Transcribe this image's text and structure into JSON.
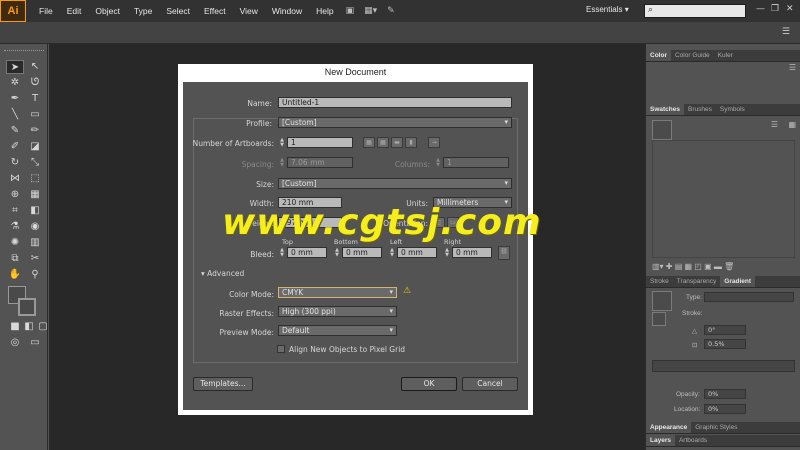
{
  "app": {
    "logo": "Ai",
    "workspace": "Essentials"
  },
  "menu": [
    "File",
    "Edit",
    "Object",
    "Type",
    "Select",
    "Effect",
    "View",
    "Window",
    "Help"
  ],
  "right_panels": {
    "top_tabs": [
      "Color",
      "Color Guide",
      "Kuler"
    ],
    "swatch_tabs": [
      "Swatches",
      "Brushes",
      "Symbols"
    ],
    "gradient_tabs": [
      "Stroke",
      "Transparency",
      "Gradient"
    ],
    "gradient": {
      "type_label": "Type:",
      "stroke_label": "Stroke:",
      "angle_value": "0°",
      "percent_value": "0.5%",
      "opacity_label": "Opacity:",
      "opacity_value": "0%",
      "location_label": "Location:",
      "location_value": "0%"
    },
    "appearance_tabs": [
      "Appearance",
      "Graphic Styles"
    ],
    "layers_tabs": [
      "Layers",
      "Artboards"
    ]
  },
  "dialog": {
    "title": "New Document",
    "name_label": "Name:",
    "name_value": "Untitled-1",
    "profile_label": "Profile:",
    "profile_value": "[Custom]",
    "artboards_label": "Number of Artboards:",
    "artboards_value": "1",
    "spacing_label": "Spacing:",
    "spacing_value": "7.06 mm",
    "columns_label": "Columns:",
    "columns_value": "1",
    "size_label": "Size:",
    "size_value": "[Custom]",
    "width_label": "Width:",
    "width_value": "210 mm",
    "units_label": "Units:",
    "units_value": "Millimeters",
    "height_label": "Height:",
    "height_value": "297 mm",
    "orientation_label": "Orientation:",
    "bleed_label": "Bleed:",
    "bleed_top_label": "Top",
    "bleed_bottom_label": "Bottom",
    "bleed_left_label": "Left",
    "bleed_right_label": "Right",
    "bleed_top": "0 mm",
    "bleed_bottom": "0 mm",
    "bleed_left": "0 mm",
    "bleed_right": "0 mm",
    "advanced_label": "Advanced",
    "color_mode_label": "Color Mode:",
    "color_mode_value": "CMYK",
    "raster_label": "Raster Effects:",
    "raster_value": "High (300 ppi)",
    "preview_label": "Preview Mode:",
    "preview_value": "Default",
    "align_label": "Align New Objects to Pixel Grid",
    "templates_button": "Templates...",
    "ok_button": "OK",
    "cancel_button": "Cancel"
  },
  "watermark": "www.cgtsj.com"
}
